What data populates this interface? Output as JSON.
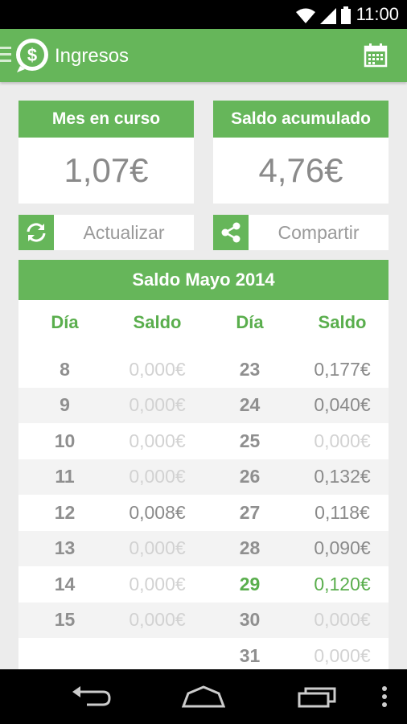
{
  "status": {
    "time": "11:00"
  },
  "app": {
    "title": "Ingresos"
  },
  "cards": {
    "month": {
      "label": "Mes en curso",
      "value": "1,07€"
    },
    "accumulated": {
      "label": "Saldo acumulado",
      "value": "4,76€"
    }
  },
  "buttons": {
    "update": "Actualizar",
    "share": "Compartir"
  },
  "table": {
    "title": "Saldo Mayo 2014",
    "headers": [
      "Día",
      "Saldo",
      "Día",
      "Saldo"
    ],
    "rows": [
      {
        "d1": "8",
        "s1": "0,000€",
        "d2": "23",
        "s2": "0,177€"
      },
      {
        "d1": "9",
        "s1": "0,000€",
        "d2": "24",
        "s2": "0,040€"
      },
      {
        "d1": "10",
        "s1": "0,000€",
        "d2": "25",
        "s2": "0,000€"
      },
      {
        "d1": "11",
        "s1": "0,000€",
        "d2": "26",
        "s2": "0,132€"
      },
      {
        "d1": "12",
        "s1": "0,008€",
        "d2": "27",
        "s2": "0,118€"
      },
      {
        "d1": "13",
        "s1": "0,000€",
        "d2": "28",
        "s2": "0,090€"
      },
      {
        "d1": "14",
        "s1": "0,000€",
        "d2": "29",
        "s2": "0,120€"
      },
      {
        "d1": "15",
        "s1": "0,000€",
        "d2": "30",
        "s2": "0,000€"
      },
      {
        "d1": "",
        "s1": "",
        "d2": "31",
        "s2": "0,000€"
      }
    ]
  },
  "colors": {
    "accent": "#66b65a",
    "highlight": "#5aae4d"
  }
}
